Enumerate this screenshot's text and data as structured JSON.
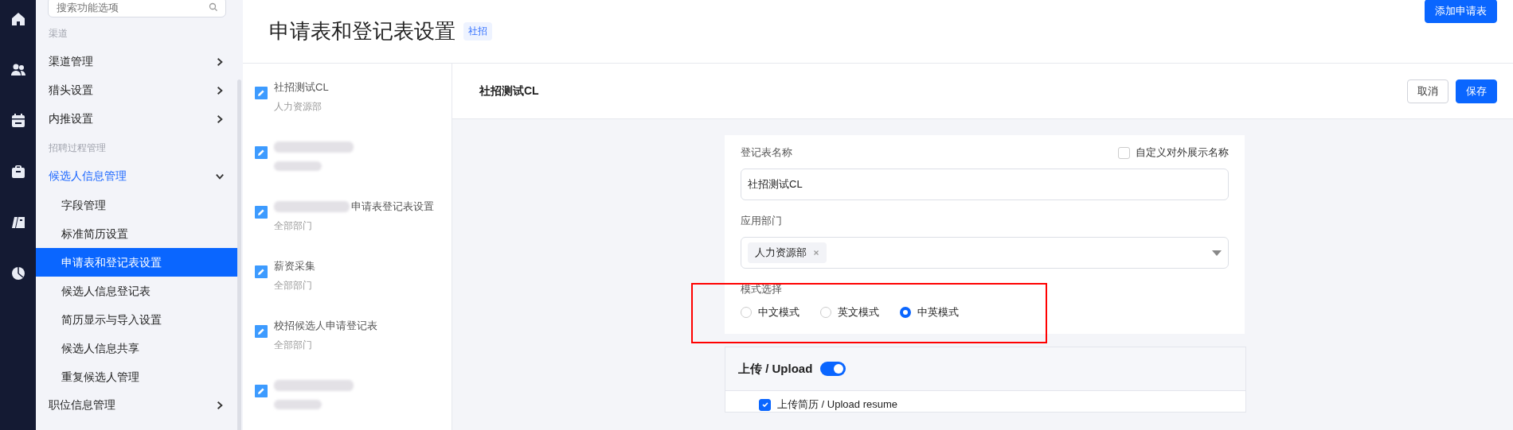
{
  "sidebar": {
    "search": {
      "placeholder": "搜索功能选项"
    },
    "items": [
      {
        "kind": "group",
        "label": "渠道"
      },
      {
        "kind": "item",
        "label": "渠道管理",
        "expanded": false
      },
      {
        "kind": "item",
        "label": "猎头设置",
        "expanded": false
      },
      {
        "kind": "item",
        "label": "内推设置",
        "expanded": false
      },
      {
        "kind": "group",
        "label": "招聘过程管理"
      },
      {
        "kind": "item",
        "label": "候选人信息管理",
        "expanded": true,
        "children": [
          {
            "label": "字段管理",
            "selected": false
          },
          {
            "label": "标准简历设置",
            "selected": false
          },
          {
            "label": "申请表和登记表设置",
            "selected": true
          },
          {
            "label": "候选人信息登记表",
            "selected": false
          },
          {
            "label": "简历显示与导入设置",
            "selected": false
          },
          {
            "label": "候选人信息共享",
            "selected": false
          },
          {
            "label": "重复候选人管理",
            "selected": false
          }
        ]
      },
      {
        "kind": "item",
        "label": "职位信息管理",
        "expanded": false
      }
    ]
  },
  "page": {
    "title": "申请表和登记表设置",
    "tag": "社招",
    "add_button": "添加申请表"
  },
  "forms": [
    {
      "name": "社招测试CL",
      "department": "人力资源部",
      "redacted": false
    },
    {
      "redacted": true
    },
    {
      "name": "申请表登记表设置",
      "department": "全部部门",
      "redacted": true
    },
    {
      "name": "薪资采集",
      "department": "全部部门",
      "redacted": false
    },
    {
      "name": "校招候选人申请登记表",
      "department": "全部部门",
      "redacted": false
    },
    {
      "redacted": true
    }
  ],
  "detail": {
    "title": "社招测试CL",
    "buttons": [
      {
        "label": "取消",
        "kind": "secondary"
      },
      {
        "label": "保存",
        "kind": "primary"
      }
    ]
  },
  "form": {
    "name_label": "登记表名称",
    "custom_name": {
      "label": "自定义对外展示名称",
      "checked": false
    },
    "name_value": "社招测试CL",
    "dept_label": "应用部门",
    "dept_tags": [
      "人力资源部"
    ],
    "mode_label": "模式选择",
    "modes": [
      {
        "label": "中文模式",
        "selected": false
      },
      {
        "label": "英文模式",
        "selected": false
      },
      {
        "label": "中英模式",
        "selected": true
      }
    ]
  },
  "upload": {
    "title": "上传 / Upload",
    "on": true,
    "items": [
      {
        "label": "上传简历 / Upload resume",
        "checked": true
      }
    ]
  }
}
